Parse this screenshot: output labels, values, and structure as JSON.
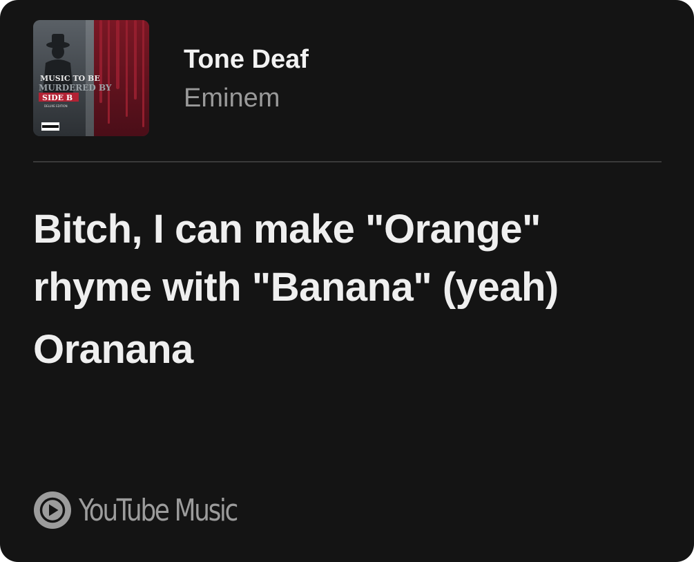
{
  "track": {
    "title": "Tone Deaf",
    "artist": "Eminem"
  },
  "album_art": {
    "icon": "album-cover",
    "text_line1": "MUSIC TO BE",
    "text_line2": "MURDERED BY",
    "text_line3": "SIDE B",
    "text_line4": "DELUXE EDITION",
    "advisory": "PARENTAL ADVISORY EXPLICIT CONTENT"
  },
  "lyrics": [
    "Bitch, I can make \"Orange\" rhyme with \"Banana\" (yeah)",
    "Oranana"
  ],
  "branding": {
    "icon": "youtube-music-icon",
    "label": "YouTube Music"
  },
  "colors": {
    "background": "#141414",
    "text_primary": "#efefef",
    "text_secondary": "#9a9a9a",
    "divider": "#3a3a3a"
  }
}
